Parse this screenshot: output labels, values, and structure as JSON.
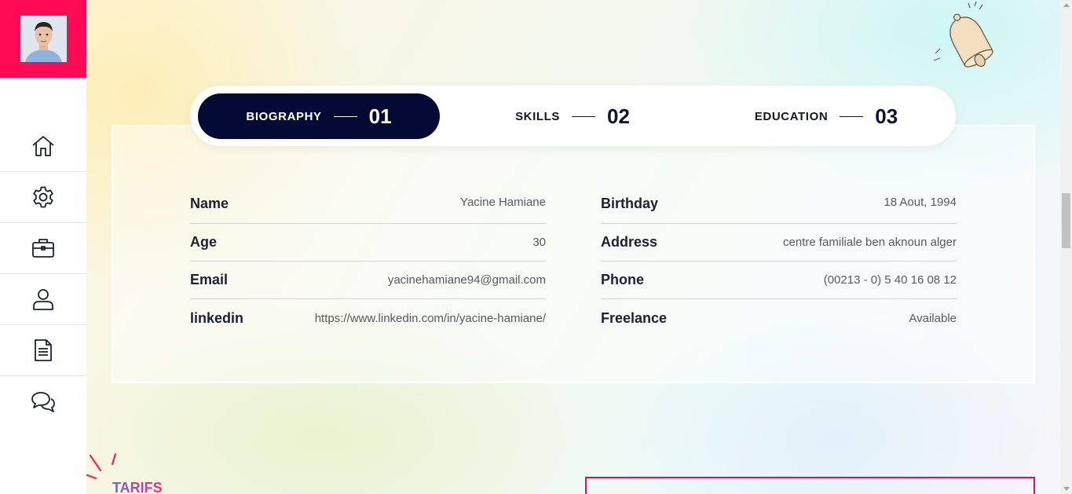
{
  "sidebar": {
    "accent_color": "#ff0a54",
    "nav_items": [
      {
        "icon": "home-icon"
      },
      {
        "icon": "gear-icon"
      },
      {
        "icon": "briefcase-icon"
      },
      {
        "icon": "user-icon"
      },
      {
        "icon": "document-icon"
      },
      {
        "icon": "chat-icon"
      }
    ]
  },
  "tabs": [
    {
      "label": "BIOGRAPHY",
      "number": "01",
      "active": true
    },
    {
      "label": "SKILLS",
      "number": "02",
      "active": false
    },
    {
      "label": "EDUCATION",
      "number": "03",
      "active": false
    }
  ],
  "bio": {
    "left": [
      {
        "key": "Name",
        "value": "Yacine Hamiane"
      },
      {
        "key": "Age",
        "value": "30"
      },
      {
        "key": "Email",
        "value": "yacinehamiane94@gmail.com"
      },
      {
        "key": "linkedin",
        "value": "https://www.linkedin.com/in/yacine-hamiane/"
      }
    ],
    "right": [
      {
        "key": "Birthday",
        "value": "18 Aout, 1994"
      },
      {
        "key": "Address",
        "value": "centre familiale ben aknoun alger"
      },
      {
        "key": "Phone",
        "value": "(00213 - 0) 5 40 16 08 12"
      },
      {
        "key": "Freelance",
        "value": "Available"
      }
    ]
  },
  "section": {
    "title": "TARIFS"
  },
  "colors": {
    "tab_active": "#050a35",
    "pricing_border": "#e0105a"
  }
}
